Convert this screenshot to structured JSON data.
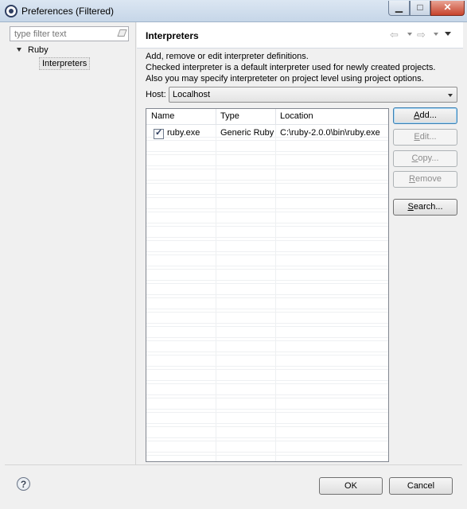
{
  "window": {
    "title": "Preferences (Filtered)",
    "controls": {
      "minimize": "▁",
      "maximize": "□",
      "close": "✕"
    }
  },
  "filter": {
    "placeholder": "type filter text"
  },
  "tree": {
    "root": "Ruby",
    "child": "Interpreters"
  },
  "page": {
    "title": "Interpreters",
    "nav": {
      "back": "⇦",
      "forward": "⇨"
    },
    "description": [
      "Add, remove or edit interpreter definitions.",
      "Checked interpreter is a default interpreter used for newly created projects.",
      "Also you may specify interpreteter on project level using project options."
    ]
  },
  "host": {
    "label": "Host:",
    "value": "Localhost"
  },
  "table": {
    "headers": [
      "Name",
      "Type",
      "Location"
    ],
    "rows": [
      {
        "checked": true,
        "name": "ruby.exe",
        "type": "Generic Ruby",
        "location": "C:\\ruby-2.0.0\\bin\\ruby.exe"
      }
    ]
  },
  "buttons": {
    "add": {
      "mnemonic": "A",
      "rest": "dd..."
    },
    "edit": {
      "mnemonic": "E",
      "rest": "dit..."
    },
    "copy": {
      "mnemonic": "C",
      "rest": "opy..."
    },
    "remove": {
      "mnemonic": "R",
      "rest": "emove"
    },
    "search": {
      "mnemonic": "S",
      "rest": "earch..."
    },
    "ok": "OK",
    "cancel": "Cancel"
  },
  "icons": {
    "help": "?"
  }
}
